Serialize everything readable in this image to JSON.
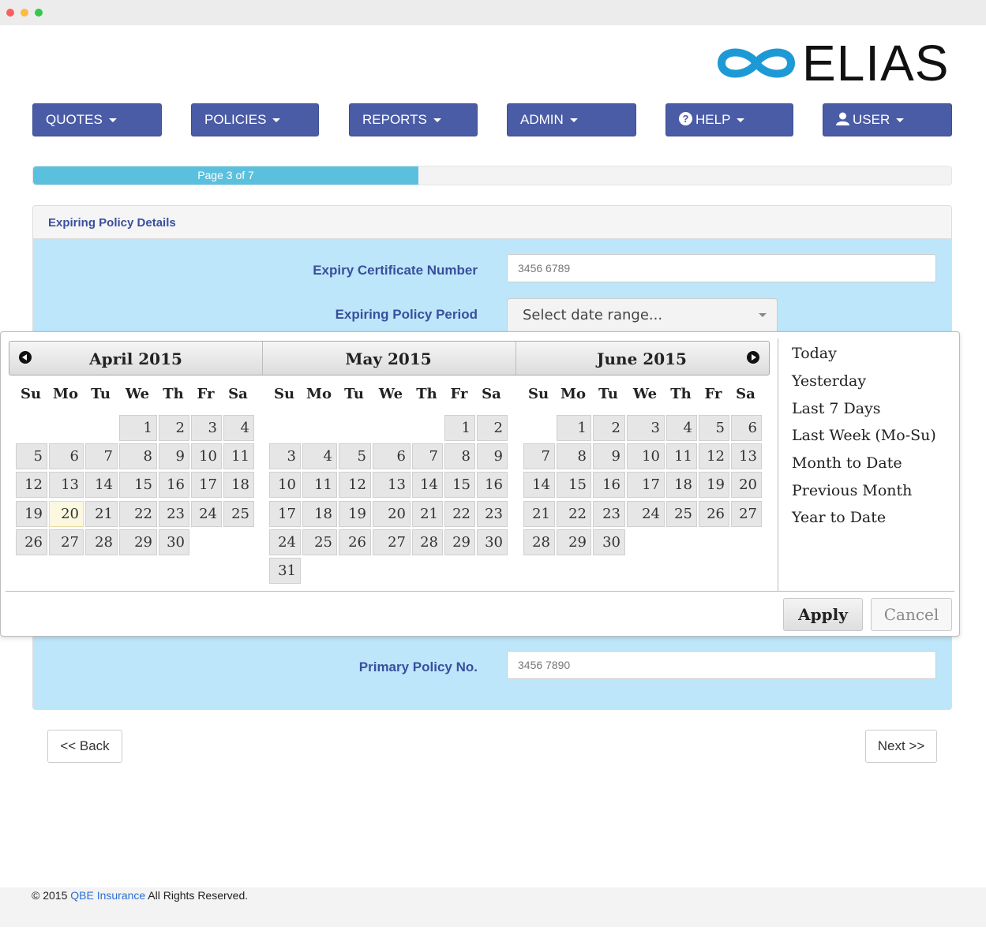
{
  "logo": {
    "text": "ELIAS",
    "accent": "#1d9ad6"
  },
  "nav": [
    {
      "label": "QUOTES",
      "icon": ""
    },
    {
      "label": "POLICIES",
      "icon": ""
    },
    {
      "label": "REPORTS",
      "icon": ""
    },
    {
      "label": "ADMIN",
      "icon": ""
    },
    {
      "label": "HELP",
      "icon": "question-circle-icon"
    },
    {
      "label": "USER",
      "icon": "user-icon"
    }
  ],
  "progress": {
    "label": "Page 3 of 7",
    "fraction": 0.42
  },
  "panel": {
    "title": "Expiring Policy Details",
    "expiry_cert_label": "Expiry Certificate Number",
    "expiry_cert_value": "3456 6789",
    "policy_period_label": "Expiring Policy Period",
    "policy_period_placeholder": "Select date range...",
    "primary_policy_label": "Primary Policy No.",
    "primary_policy_value": "3456 7890"
  },
  "calendar": {
    "weekdays": [
      "Su",
      "Mo",
      "Tu",
      "We",
      "Th",
      "Fr",
      "Sa"
    ],
    "months": [
      {
        "title": "April 2015",
        "first_weekday": 3,
        "days": 30,
        "highlight": 20
      },
      {
        "title": "May 2015",
        "first_weekday": 5,
        "days": 31,
        "highlight": null
      },
      {
        "title": "June 2015",
        "first_weekday": 1,
        "days": 30,
        "highlight": null
      }
    ],
    "ranges": [
      "Today",
      "Yesterday",
      "Last 7 Days",
      "Last Week (Mo-Su)",
      "Month to Date",
      "Previous Month",
      "Year to Date"
    ],
    "apply_label": "Apply",
    "cancel_label": "Cancel"
  },
  "buttons": {
    "back": "<< Back",
    "next": "Next >>"
  },
  "footer": {
    "prefix": "© 2015 ",
    "link": "QBE Insurance",
    "suffix": " All Rights Reserved."
  }
}
